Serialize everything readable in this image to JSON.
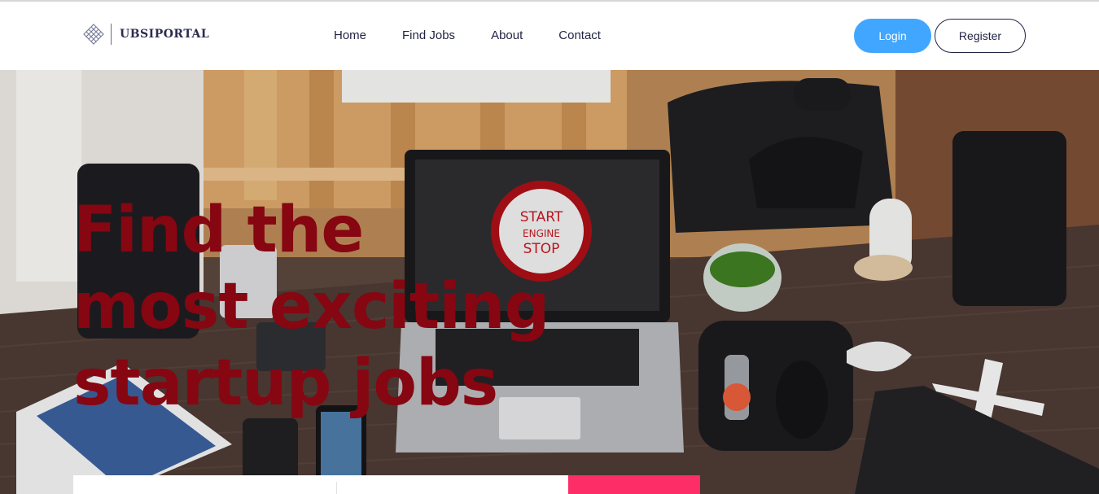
{
  "brand": {
    "name": "UBSIPORTAL"
  },
  "nav": {
    "items": [
      {
        "label": "Home"
      },
      {
        "label": "Find Jobs"
      },
      {
        "label": "About"
      },
      {
        "label": "Contact"
      }
    ]
  },
  "auth": {
    "login_label": "Login",
    "register_label": "Register"
  },
  "hero": {
    "title_lines": [
      "Find the",
      "most exciting",
      "startup jobs"
    ],
    "laptop_screen_text": [
      "START",
      "ENGINE",
      "STOP"
    ]
  },
  "search": {
    "keyword_placeholder": "",
    "location_placeholder": "",
    "button_label": ""
  },
  "colors": {
    "accent_blue": "#41a6ff",
    "hero_title": "#860612",
    "search_button": "#fc2d67",
    "nav_text": "#1f2341"
  }
}
